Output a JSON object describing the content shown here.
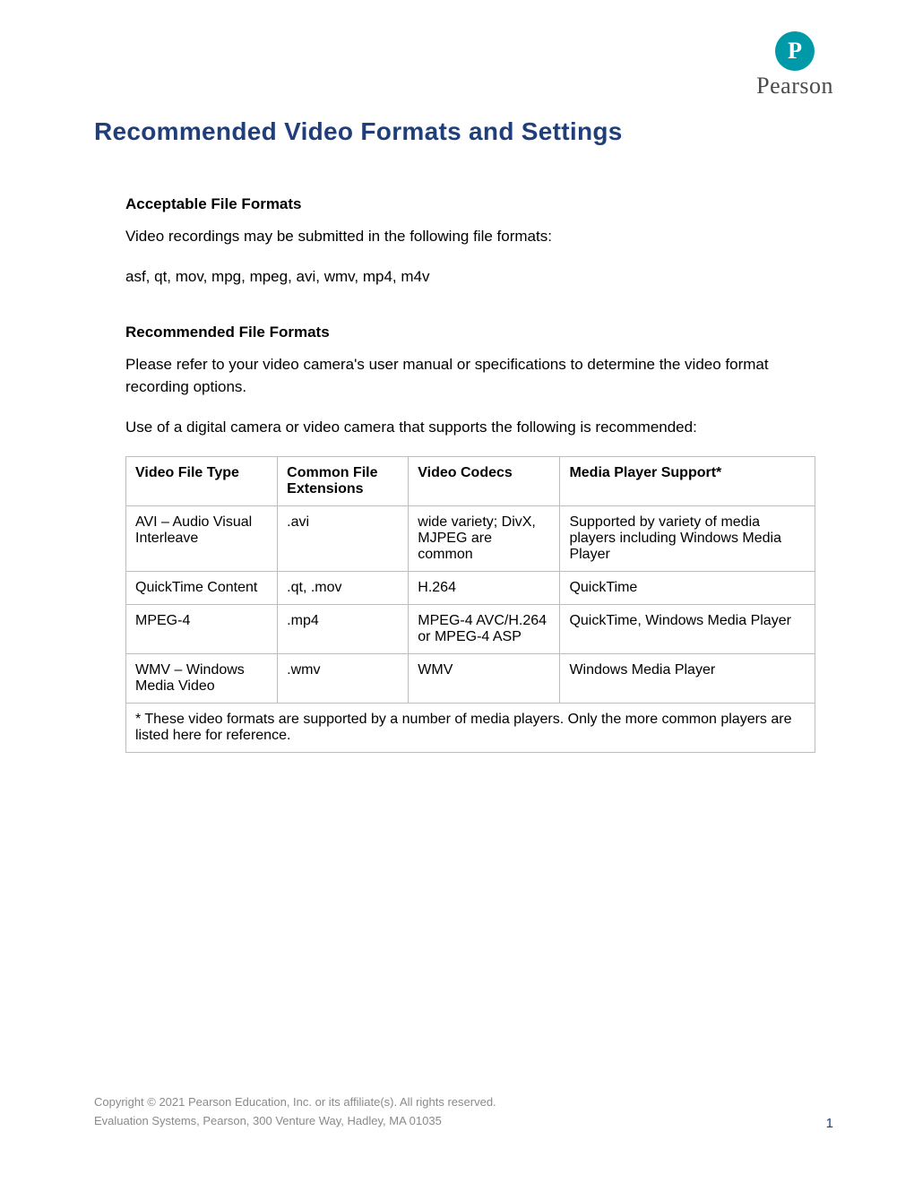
{
  "logo": {
    "glyph": "P",
    "text": "Pearson"
  },
  "title": "Recommended Video Formats and Settings",
  "section1": {
    "heading": "Acceptable File Formats",
    "p1": "Video recordings may be submitted in the following file formats:",
    "p2": "asf, qt, mov, mpg, mpeg, avi, wmv, mp4, m4v"
  },
  "section2": {
    "heading": "Recommended File Formats",
    "p1": "Please refer to your video camera's user manual or specifications to determine the video format recording options.",
    "p2": "Use of a digital camera or video camera that supports the following is recommended:"
  },
  "table": {
    "headers": [
      "Video File Type",
      "Common File Extensions",
      "Video Codecs",
      "Media Player Support*"
    ],
    "rows": [
      [
        "AVI – Audio Visual Interleave",
        ".avi",
        "wide variety; DivX, MJPEG are common",
        "Supported by variety of media players including Windows Media Player"
      ],
      [
        "QuickTime Content",
        ".qt, .mov",
        "H.264",
        "QuickTime"
      ],
      [
        "MPEG-4",
        ".mp4",
        "MPEG-4 AVC/H.264 or MPEG-4 ASP",
        "QuickTime, Windows Media Player"
      ],
      [
        "WMV – Windows Media Video",
        ".wmv",
        "WMV",
        "Windows Media Player"
      ]
    ],
    "note": "* These video formats are supported by a number of media players. Only the more common players are listed here for reference."
  },
  "footer": {
    "copyright": "Copyright © 2021 Pearson Education, Inc. or its affiliate(s). All rights reserved.",
    "address": "Evaluation Systems, Pearson, 300 Venture Way, Hadley, MA 01035",
    "page": "1"
  }
}
